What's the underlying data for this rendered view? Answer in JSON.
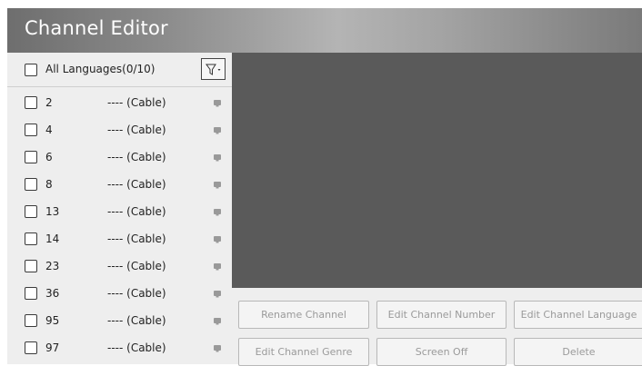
{
  "header": {
    "title": "Channel Editor"
  },
  "filter": {
    "all_label": "All Languages(0/10)",
    "filter_icon": "filter-icon"
  },
  "channels": [
    {
      "number": "2",
      "name": "---- (Cable)"
    },
    {
      "number": "4",
      "name": "---- (Cable)"
    },
    {
      "number": "6",
      "name": "---- (Cable)"
    },
    {
      "number": "8",
      "name": "---- (Cable)"
    },
    {
      "number": "13",
      "name": "---- (Cable)"
    },
    {
      "number": "14",
      "name": "---- (Cable)"
    },
    {
      "number": "23",
      "name": "---- (Cable)"
    },
    {
      "number": "36",
      "name": "---- (Cable)"
    },
    {
      "number": "95",
      "name": "---- (Cable)"
    },
    {
      "number": "97",
      "name": "---- (Cable)"
    }
  ],
  "actions": {
    "rename_channel": "Rename Channel",
    "edit_channel_number": "Edit Channel Number",
    "edit_channel_language": "Edit Channel Language",
    "edit_channel_genre": "Edit Channel Genre",
    "screen_off": "Screen Off",
    "delete": "Delete"
  },
  "colors": {
    "preview_bg": "#5a5a5a",
    "panel_bg": "#eeeeee",
    "disabled_text": "#9a9a9a"
  }
}
